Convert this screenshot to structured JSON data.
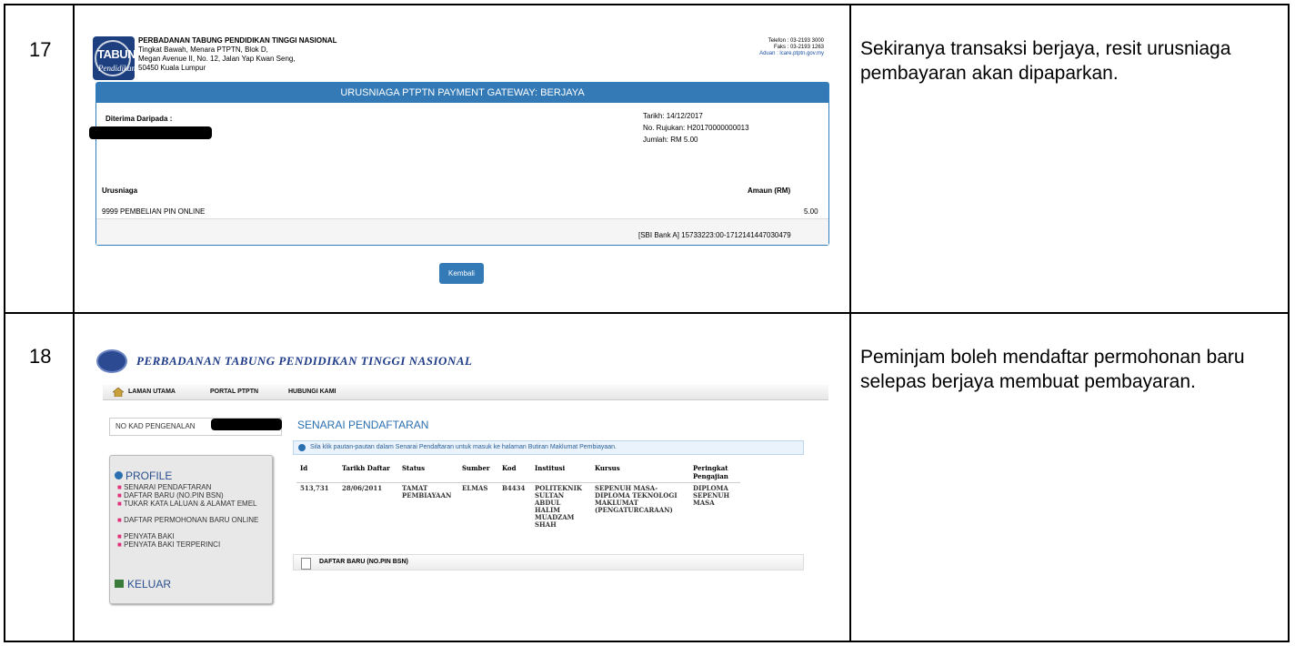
{
  "rows": [
    {
      "number": "17",
      "description": "Sekiranya transaksi berjaya, resit urusniaga pembayaran akan dipaparkan."
    },
    {
      "number": "18",
      "description": "Peminjam boleh mendaftar permohonan baru selepas berjaya membuat pembayaran."
    }
  ],
  "receipt": {
    "logo_text": "TABUNG",
    "logo_script": "Pendidikan",
    "org_name": "PERBADANAN TABUNG PENDIDIKAN TINGGI NASIONAL",
    "address1": "Tingkat Bawah, Menara PTPTN, Blok D,",
    "address2": "Megan Avenue II, No. 12, Jalan Yap Kwan Seng,",
    "address3": "50450 Kuala Lumpur",
    "telefon": "Telefon : 03-2193 3000",
    "faks": "Faks : 03-2193 1263",
    "aduan": "Aduan : lcare.ptptn.gov.my",
    "banner": "URUSNIAGA PTPTN PAYMENT GATEWAY: BERJAYA",
    "received_from_label": "Diterima Daripada :",
    "tarikh": "Tarikh: 14/12/2017",
    "rujukan": "No. Rujukan: H20170000000013",
    "jumlah": "Jumlah: RM 5.00",
    "col_urusniaga": "Urusniaga",
    "col_amaun": "Amaun (RM)",
    "item_desc": "9999 PEMBELIAN PIN ONLINE",
    "item_amount": "5.00",
    "footer_ref": "[SBI Bank A] 15733223:00-1712141447030479",
    "back_button": "Kembali"
  },
  "portal": {
    "title": "PERBADANAN TABUNG PENDIDIKAN TINGGI NASIONAL",
    "nav": [
      "LAMAN UTAMA",
      "PORTAL PTPTN",
      "HUBUNGI KAMI"
    ],
    "nokad_label": "NO KAD PENGENALAN",
    "profile_label": "PROFILE",
    "menu": [
      "SENARAI PENDAFTARAN",
      "DAFTAR BARU (NO.PIN BSN)",
      "TUKAR KATA LALUAN & ALAMAT EMEL",
      "DAFTAR PERMOHONAN BARU ONLINE",
      "PENYATA BAKI",
      "PENYATA BAKI TERPERINCI"
    ],
    "keluar_label": "KELUAR",
    "section_title": "SENARAI PENDAFTARAN",
    "info_text": "Sila klik pautan-pautan dalam Senarai Pendaftaran untuk masuk ke halaman Butiran Maklumat Pembiayaan.",
    "table": {
      "headers": [
        "Id",
        "Tarikh Daftar",
        "Status",
        "Sumber",
        "Kod",
        "Institusi",
        "Kursus",
        "Peringkat Pengajian"
      ],
      "row": [
        "513,731",
        "28/06/2011",
        "TAMAT PEMBIAYAAN",
        "ELMAS",
        "B4434",
        "POLITEKNIK SULTAN ABDUL HALIM MUADZAM SHAH",
        "SEPENUH MASA-DIPLOMA TEKNOLOGI MAKLUMAT (PENGATURCARAAN)",
        "DIPLOMA SEPENUH MASA"
      ]
    },
    "daftar_link": "DAFTAR BARU (NO.PIN BSN)"
  }
}
